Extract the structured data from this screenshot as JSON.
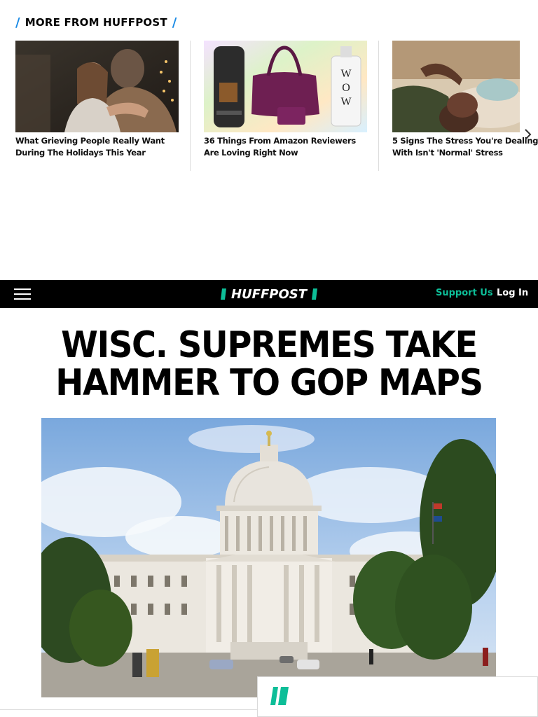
{
  "more_from": {
    "title": "MORE FROM HUFFPOST",
    "cards": [
      {
        "caption": "What Grieving People Really Want During The Holidays This Year",
        "image": "couple-hugging-holiday-photo"
      },
      {
        "caption": "36 Things From Amazon Reviewers Are Loving Right Now",
        "image": "amazon-products-photo"
      },
      {
        "caption": "5 Signs The Stress You're Dealing With Isn't 'Normal' Stress",
        "image": "stressed-man-lying-down-photo"
      }
    ],
    "next_icon": "chevron-right-icon"
  },
  "nav": {
    "menu_icon": "hamburger-menu-icon",
    "logo_text": "HUFFPOST",
    "support_label": "Support Us",
    "login_label": "Log In",
    "support_color": "#0dbe98"
  },
  "article": {
    "headline": "WISC. SUPREMES TAKE HAMMER TO GOP MAPS",
    "hero_image": "wisconsin-state-capitol-photo"
  },
  "ad": {
    "logo_icon": "huffpost-slash-logo-icon",
    "accent": "#0dbe98"
  }
}
